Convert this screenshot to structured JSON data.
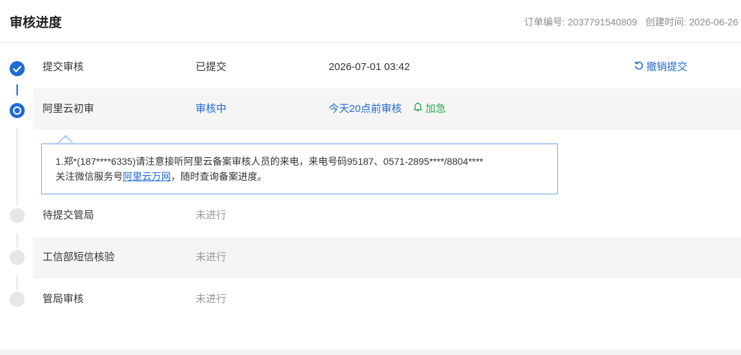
{
  "header": {
    "title": "审核进度",
    "order_no": "订单编号: 2037791540809",
    "created": "创建时间: 2026-06-26"
  },
  "steps": [
    {
      "name": "提交审核",
      "status": "已提交",
      "time": "2026-07-01 03:42",
      "action": "撤销提交"
    },
    {
      "name": "阿里云初审",
      "status": "审核中",
      "time": "今天20点前审核",
      "urgent": "加急"
    },
    {
      "name": "待提交管局",
      "status": "未进行"
    },
    {
      "name": "工信部短信核验",
      "status": "未进行"
    },
    {
      "name": "管局审核",
      "status": "未进行"
    }
  ],
  "notice": {
    "line1": "1.郑*(187****6335)请注意接听阿里云备案审核人员的来电，来电号码95187、0571-2895****/8804****",
    "line2_prefix": "关注微信服务号",
    "line2_link": "阿里云万网",
    "line2_suffix": "，随时查询备案进度。"
  },
  "colors": {
    "accent": "#1f6ad6",
    "urgent": "#2fa84f",
    "pending": "#999999"
  },
  "icons": {
    "done": "check-circle-icon",
    "current": "progress-circle-icon",
    "todo": "grey-circle-icon",
    "undo": "undo-icon",
    "bell": "bell-icon"
  }
}
